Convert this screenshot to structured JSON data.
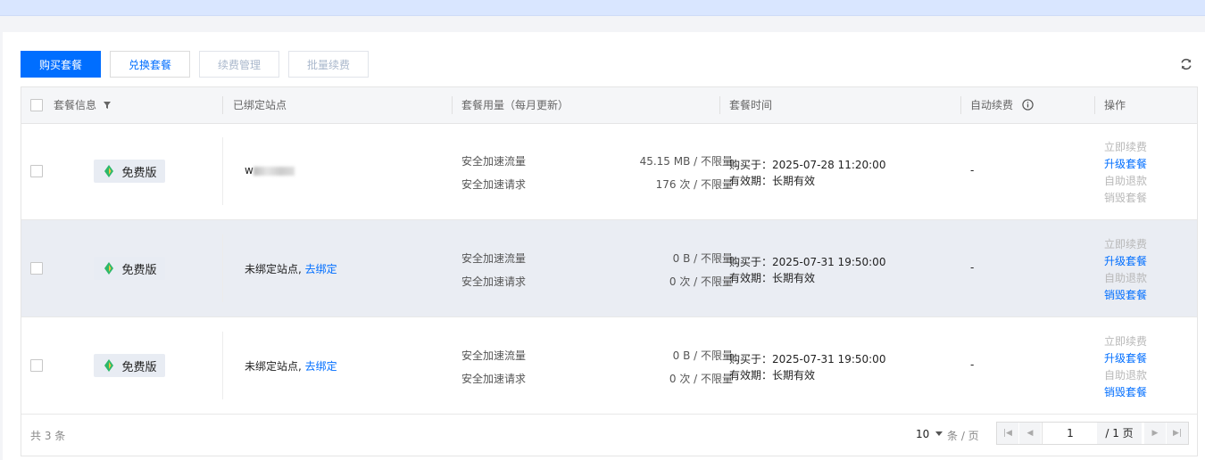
{
  "toolbar": {
    "buy_label": "购买套餐",
    "exchange_label": "兑换套餐",
    "renew_manage_label": "续费管理",
    "batch_renew_label": "批量续费"
  },
  "table": {
    "headers": {
      "plan_info": "套餐信息",
      "bound_site": "已绑定站点",
      "usage": "套餐用量（每月更新）",
      "time": "套餐时间",
      "auto_renew": "自动续费",
      "actions": "操作"
    },
    "rows": [
      {
        "plan": "免费版",
        "site_prefix": "w",
        "site_text": "",
        "site_link": "",
        "traffic_label": "安全加速流量",
        "traffic_value": "45.15 MB / 不限量",
        "requests_label": "安全加速请求",
        "requests_value": "176 次 / 不限量",
        "purchased": "购买于：2025-07-28 11:20:00",
        "validity": "有效期：长期有效",
        "auto_renew": "-",
        "actions": [
          "立即续费",
          "升级套餐",
          "自助退款",
          "销毁套餐"
        ]
      },
      {
        "plan": "免费版",
        "site_prefix": "",
        "site_text": "未绑定站点, ",
        "site_link": "去绑定",
        "traffic_label": "安全加速流量",
        "traffic_value": "0 B / 不限量",
        "requests_label": "安全加速请求",
        "requests_value": "0 次 / 不限量",
        "purchased": "购买于：2025-07-31 19:50:00",
        "validity": "有效期：长期有效",
        "auto_renew": "-",
        "actions": [
          "立即续费",
          "升级套餐",
          "自助退款",
          "销毁套餐"
        ]
      },
      {
        "plan": "免费版",
        "site_prefix": "",
        "site_text": "未绑定站点, ",
        "site_link": "去绑定",
        "traffic_label": "安全加速流量",
        "traffic_value": "0 B / 不限量",
        "requests_label": "安全加速请求",
        "requests_value": "0 次 / 不限量",
        "purchased": "购买于：2025-07-31 19:50:00",
        "validity": "有效期：长期有效",
        "auto_renew": "-",
        "actions": [
          "立即续费",
          "升级套餐",
          "自助退款",
          "销毁套餐"
        ]
      }
    ]
  },
  "footer": {
    "total": "共 3 条",
    "page_size": "10",
    "page_size_unit": "条 / 页",
    "current_page": "1",
    "total_pages": "/ 1 页"
  },
  "colors": {
    "primary": "#006eff",
    "disabled": "#b8b8b8",
    "hover_row": "#eaedf3"
  }
}
